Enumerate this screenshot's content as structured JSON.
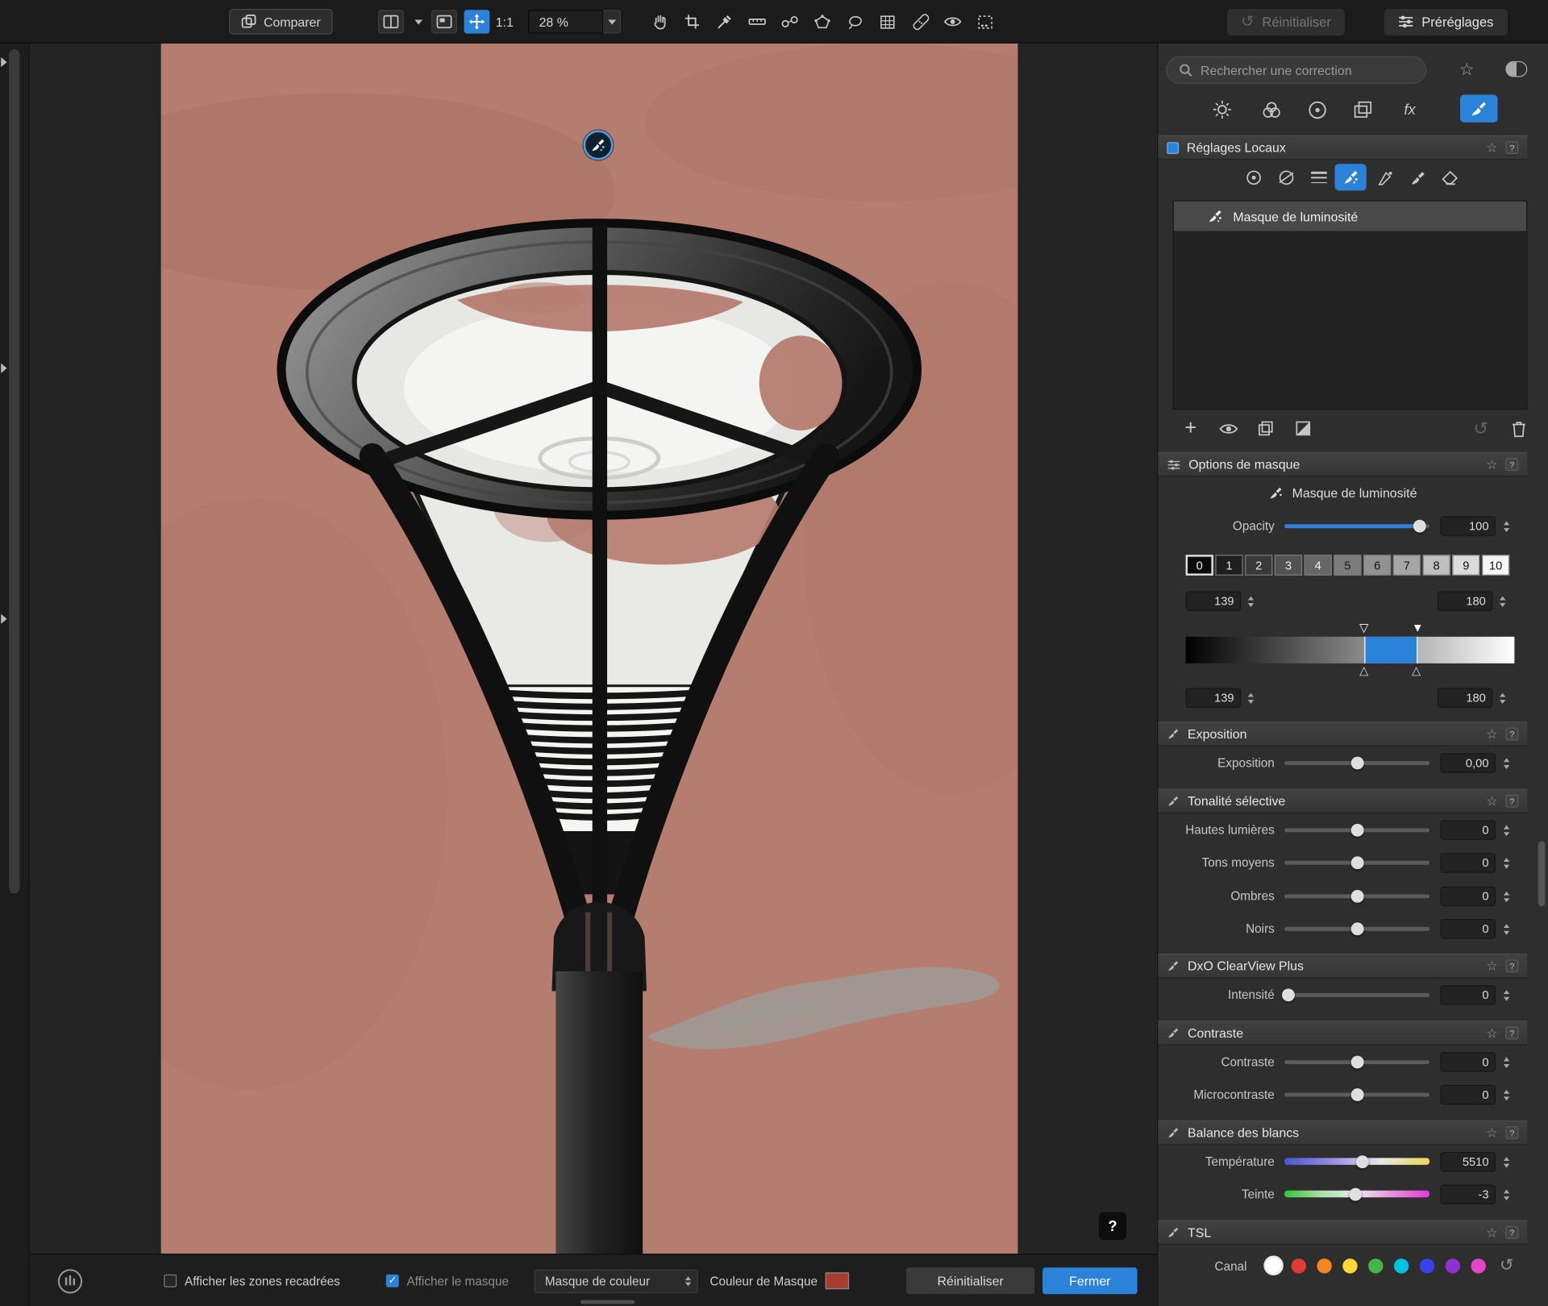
{
  "accent": "#2b82d9",
  "toolbar": {
    "compare": "Comparer",
    "one_to_one": "1:1",
    "zoom": "28 %",
    "reset": "Réinitialiser",
    "presets": "Préréglages"
  },
  "search": {
    "placeholder": "Rechercher une correction"
  },
  "local_panel": {
    "title": "Réglages Locaux",
    "selected_item": "Masque de luminosité"
  },
  "mask_options": {
    "title": "Options de masque",
    "mask_name": "Masque de luminosité",
    "opacity_label": "Opacity",
    "opacity_value": "100",
    "zones": [
      "0",
      "1",
      "2",
      "3",
      "4",
      "5",
      "6",
      "7",
      "8",
      "9",
      "10"
    ],
    "range": {
      "low": "139",
      "high": "180",
      "low2": "139",
      "high2": "180"
    }
  },
  "sections": {
    "exposition": {
      "title": "Exposition",
      "rows": [
        {
          "label": "Exposition",
          "value": "0,00"
        }
      ]
    },
    "tonalite": {
      "title": "Tonalité sélective",
      "rows": [
        {
          "label": "Hautes lumières",
          "value": "0"
        },
        {
          "label": "Tons moyens",
          "value": "0"
        },
        {
          "label": "Ombres",
          "value": "0"
        },
        {
          "label": "Noirs",
          "value": "0"
        }
      ]
    },
    "clearview": {
      "title": "DxO ClearView Plus",
      "rows": [
        {
          "label": "Intensité",
          "value": "0"
        }
      ]
    },
    "contraste": {
      "title": "Contraste",
      "rows": [
        {
          "label": "Contraste",
          "value": "0"
        },
        {
          "label": "Microcontraste",
          "value": "0"
        }
      ]
    },
    "balance": {
      "title": "Balance des blancs",
      "rows": [
        {
          "label": "Température",
          "value": "5510"
        },
        {
          "label": "Teinte",
          "value": "-3"
        }
      ]
    },
    "tsl": {
      "title": "TSL",
      "canal": "Canal",
      "channels": [
        "#ffffff",
        "#e53935",
        "#f5871f",
        "#fdd835",
        "#43b54a",
        "#00c4df",
        "#3542e5",
        "#8e30d6",
        "#e245c8"
      ]
    }
  },
  "bottom_bar": {
    "show_cropped": "Afficher les zones recadrées",
    "show_mask": "Afficher le masque",
    "mask_mode": "Masque de couleur",
    "mask_color_label": "Couleur de Masque",
    "mask_color": "#a93b30",
    "reset": "Réinitialiser",
    "close": "Fermer",
    "help": "?"
  },
  "icons": {
    "star": "☆",
    "help": "?",
    "undo": "↺",
    "add": "+",
    "check": "✓",
    "fx": "fx"
  }
}
